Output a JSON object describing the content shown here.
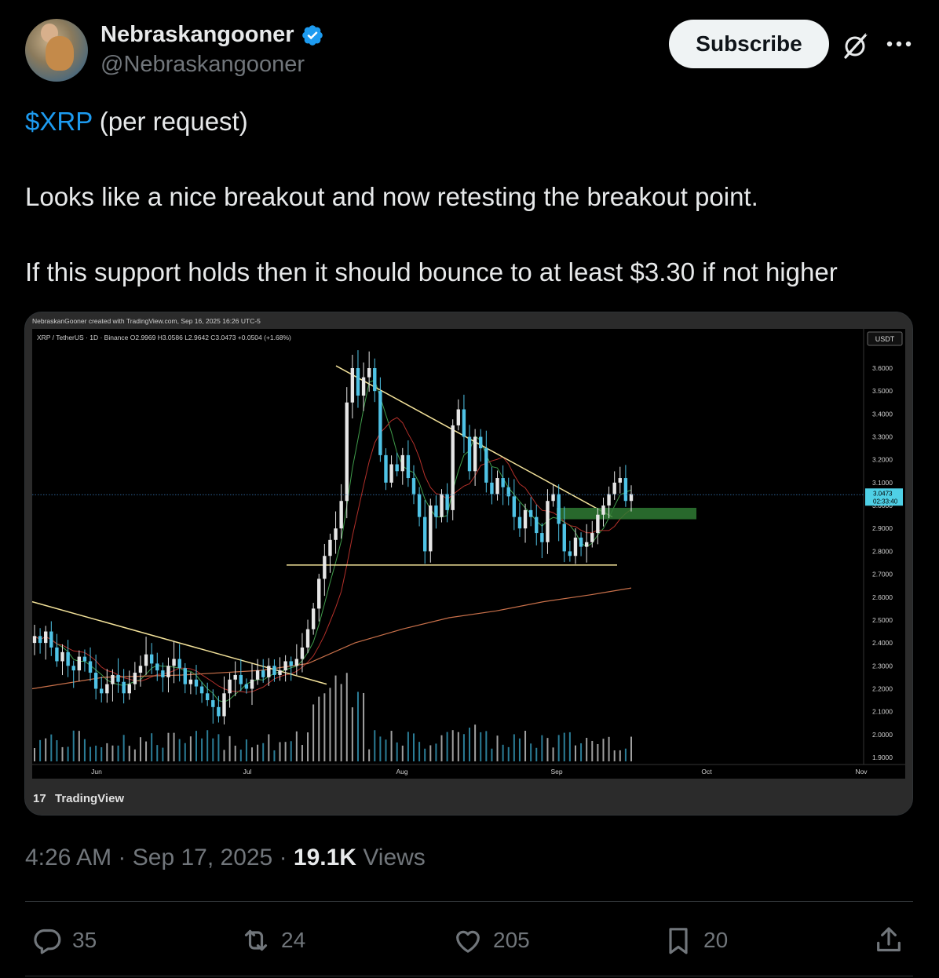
{
  "author": {
    "display_name": "Nebraskangooner",
    "handle": "@Nebraskangooner",
    "verified": true
  },
  "header": {
    "subscribe_label": "Subscribe",
    "grok_icon": "grok-icon",
    "more_icon": "more-icon"
  },
  "tweet": {
    "cashtag": "$XRP",
    "line1_rest": " (per request)",
    "line2": "Looks like a nice breakout and now retesting the breakout point.",
    "line3": "If this support holds then it should bounce to at least $3.30 if not higher"
  },
  "chart_data": {
    "type": "candlestick",
    "watermark_header": "NebraskanGooner created with TradingView.com, Sep 16, 2025 16:26 UTC-5",
    "symbol_line": "XRP / TetherUS · 1D · Binance  O2.9969  H3.0586  L2.9642  C3.0473  +0.0504 (+1.68%)",
    "currency": "USDT",
    "y_ticks": [
      "3.6000",
      "3.5000",
      "3.4000",
      "3.3000",
      "3.2000",
      "3.1000",
      "3.0000",
      "2.9000",
      "2.8000",
      "2.7000",
      "2.6000",
      "2.5000",
      "2.4000",
      "2.3000",
      "2.2000",
      "2.1000",
      "2.0000",
      "1.9000"
    ],
    "x_ticks": [
      "Jun",
      "Jul",
      "Aug",
      "Sep",
      "Oct",
      "Nov"
    ],
    "last_price": "3.0473",
    "countdown": "02:33:40",
    "logo_text": "TradingView",
    "ylim": [
      1.9,
      3.7
    ],
    "up_color": "#e6e6e6",
    "down_color": "#4fc3e6",
    "trendline_color": "#f3e29a",
    "support_level": 2.74,
    "green_zone": [
      2.94,
      2.99
    ],
    "closes": [
      2.43,
      2.4,
      2.45,
      2.38,
      2.32,
      2.36,
      2.3,
      2.28,
      2.34,
      2.32,
      2.27,
      2.2,
      2.18,
      2.22,
      2.26,
      2.23,
      2.18,
      2.22,
      2.27,
      2.3,
      2.35,
      2.31,
      2.28,
      2.25,
      2.3,
      2.33,
      2.29,
      2.22,
      2.24,
      2.21,
      2.18,
      2.15,
      2.12,
      2.08,
      2.18,
      2.24,
      2.26,
      2.22,
      2.2,
      2.24,
      2.28,
      2.25,
      2.3,
      2.26,
      2.28,
      2.32,
      2.3,
      2.33,
      2.38,
      2.46,
      2.55,
      2.68,
      2.78,
      2.85,
      2.9,
      3.02,
      3.45,
      3.6,
      3.48,
      3.56,
      3.6,
      3.5,
      3.22,
      3.1,
      3.18,
      3.15,
      3.22,
      3.12,
      3.05,
      2.95,
      2.8,
      3.0,
      2.95,
      3.05,
      2.98,
      3.35,
      3.42,
      3.3,
      3.15,
      3.3,
      3.25,
      3.1,
      3.05,
      3.12,
      3.08,
      3.04,
      2.95,
      2.9,
      2.98,
      2.95,
      2.88,
      2.84,
      3.02,
      3.05,
      2.92,
      2.8,
      2.78,
      2.86,
      2.82,
      2.84,
      2.88,
      2.96,
      3.0,
      3.05,
      3.1,
      3.12,
      3.02,
      3.05
    ]
  },
  "meta": {
    "time": "4:26 AM",
    "sep": " · ",
    "date": "Sep 17, 2025",
    "views_count": "19.1K",
    "views_label": " Views"
  },
  "actions": {
    "replies": "35",
    "reposts": "24",
    "likes": "205",
    "bookmarks": "20"
  }
}
